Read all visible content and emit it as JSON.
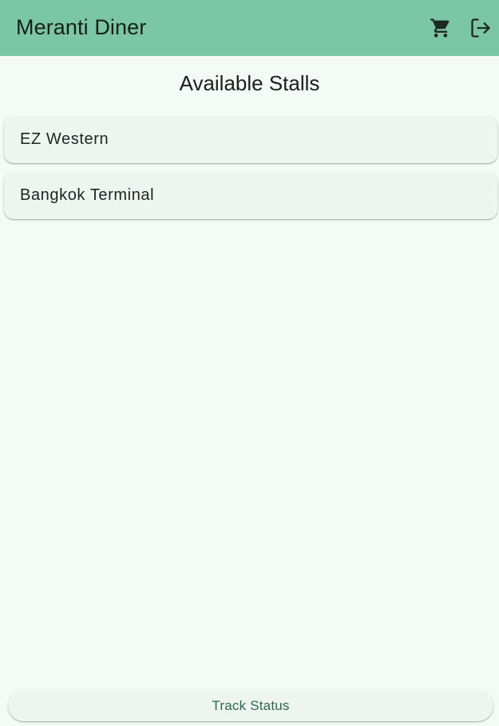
{
  "app_bar": {
    "title": "Meranti Diner",
    "background_color": "#7bc6a6",
    "actions": [
      {
        "icon": "cart-icon"
      },
      {
        "icon": "logout-icon"
      }
    ]
  },
  "main": {
    "heading": "Available Stalls",
    "stalls": [
      {
        "label": "EZ Western"
      },
      {
        "label": "Bangkok Terminal"
      }
    ]
  },
  "footer": {
    "track_button_label": "Track Status",
    "accent_color": "#2a6b4c"
  },
  "colors": {
    "page_background": "#f4faf5",
    "card_background": "#eef4f0"
  }
}
